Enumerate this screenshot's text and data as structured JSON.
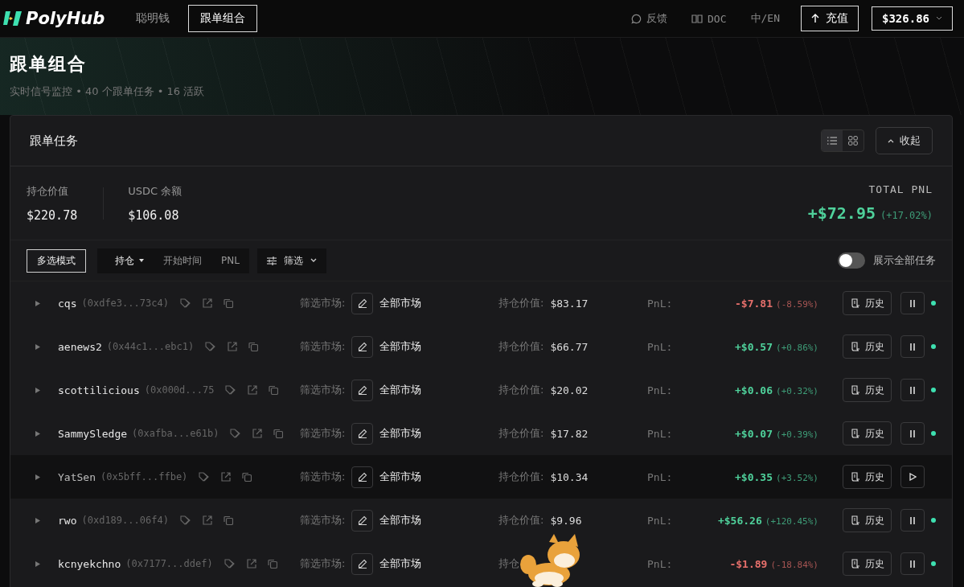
{
  "nav": {
    "logo": "PolyHub",
    "tabs": [
      {
        "label": "聪明钱",
        "selected": false
      },
      {
        "label": "跟单组合",
        "selected": true
      }
    ],
    "feedback": "反馈",
    "doc": "DOC",
    "language": "中/EN",
    "deposit": "充值",
    "balance": "$326.86"
  },
  "hero": {
    "title": "跟单组合",
    "subtitle": "实时信号监控 • 40 个跟单任务 • 16 活跃"
  },
  "panel": {
    "title": "跟单任务",
    "views": [
      {
        "kind": "list",
        "selected": true
      },
      {
        "kind": "grid",
        "selected": false
      }
    ],
    "collapse": "收起",
    "stats": [
      {
        "label": "持仓价值",
        "value": "$220.78"
      },
      {
        "label": "USDC 余额",
        "value": "$106.08"
      }
    ],
    "total_pnl": {
      "label": "TOTAL PNL",
      "value": "+$72.95",
      "percent": "(+17.02%)",
      "loss": false
    },
    "multi_select": "多选模式",
    "sorts": [
      {
        "label": "持仓",
        "selected": true
      },
      {
        "label": "开始时间",
        "selected": false
      },
      {
        "label": "PNL",
        "selected": false
      }
    ],
    "filter": "筛选",
    "show_all": {
      "label": "展示全部任务",
      "on": false
    }
  },
  "rows": [
    {
      "name": "cqs",
      "address": "(0xdfe3...73c4)",
      "filter_label": "筛选市场:",
      "market": "全部市场",
      "value_label": "持仓价值:",
      "value": "$83.17",
      "pnl_label": "PnL:",
      "pnl": "-$7.81",
      "pnl_percent": "(-8.59%)",
      "loss": true,
      "history": "历史",
      "active": true
    },
    {
      "name": "aenews2",
      "address": "(0x44c1...ebc1)",
      "filter_label": "筛选市场:",
      "market": "全部市场",
      "value_label": "持仓价值:",
      "value": "$66.77",
      "pnl_label": "PnL:",
      "pnl": "+$0.57",
      "pnl_percent": "(+0.86%)",
      "loss": false,
      "history": "历史",
      "active": true
    },
    {
      "name": "scottilicious",
      "address": "(0x000d...75",
      "filter_label": "筛选市场:",
      "market": "全部市场",
      "value_label": "持仓价值:",
      "value": "$20.02",
      "pnl_label": "PnL:",
      "pnl": "+$0.06",
      "pnl_percent": "(+0.32%)",
      "loss": false,
      "history": "历史",
      "active": true
    },
    {
      "name": "SammySledge",
      "address": "(0xafba...e61b)",
      "filter_label": "筛选市场:",
      "market": "全部市场",
      "value_label": "持仓价值:",
      "value": "$17.82",
      "pnl_label": "PnL:",
      "pnl": "+$0.07",
      "pnl_percent": "(+0.39%)",
      "loss": false,
      "history": "历史",
      "active": true
    },
    {
      "name": "YatSen",
      "address": "(0x5bff...ffbe)",
      "filter_label": "筛选市场:",
      "market": "全部市场",
      "value_label": "持仓价值:",
      "value": "$10.34",
      "pnl_label": "PnL:",
      "pnl": "+$0.35",
      "pnl_percent": "(+3.52%)",
      "loss": false,
      "history": "历史",
      "active": false
    },
    {
      "name": "rwo",
      "address": "(0xd189...06f4)",
      "filter_label": "筛选市场:",
      "market": "全部市场",
      "value_label": "持仓价值:",
      "value": "$9.96",
      "pnl_label": "PnL:",
      "pnl": "+$56.26",
      "pnl_percent": "(+120.45%)",
      "loss": false,
      "history": "历史",
      "active": true
    },
    {
      "name": "kcnyekchno",
      "address": "(0x7177...ddef)",
      "filter_label": "筛选市场:",
      "market": "全部市场",
      "value_label": "持仓",
      "pnl_label": "PnL:",
      "pnl": "-$1.89",
      "pnl_percent": "(-18.84%)",
      "loss": true,
      "history": "历史",
      "active": true
    }
  ]
}
